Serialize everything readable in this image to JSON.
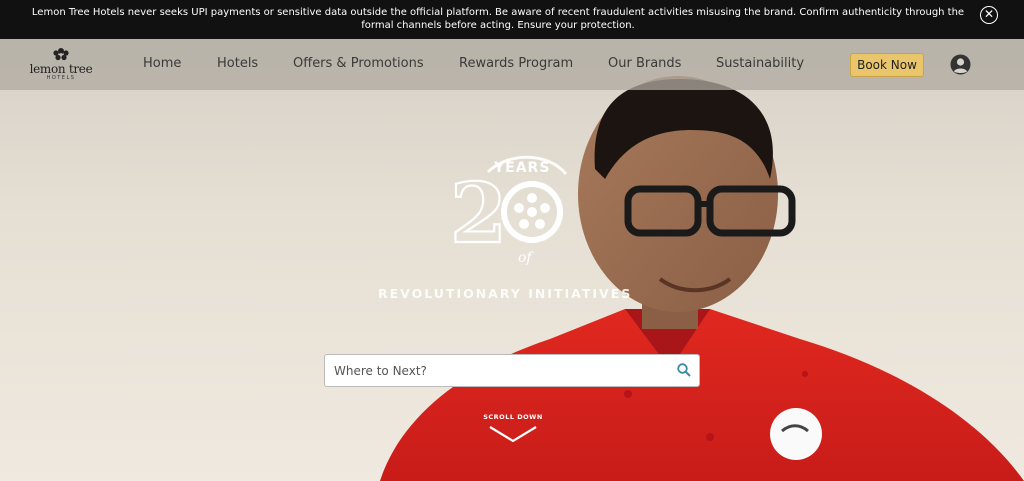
{
  "alert": {
    "message": "Lemon Tree Hotels never seeks UPI payments or sensitive data outside the official platform. Be aware of recent fraudulent activities misusing the brand. Confirm authenticity through the formal channels before acting. Ensure your protection.",
    "close_glyph": "✕"
  },
  "header": {
    "logo": {
      "name": "lemon tree",
      "sub": "HOTELS"
    },
    "nav": [
      {
        "label": "Home"
      },
      {
        "label": "Hotels"
      },
      {
        "label": "Offers & Promotions"
      },
      {
        "label": "Rewards Program"
      },
      {
        "label": "Our Brands"
      },
      {
        "label": "Sustainability"
      }
    ],
    "book_label": "Book Now"
  },
  "hero": {
    "emblem": {
      "years_text": "YEARS",
      "number_2": "2",
      "number_0": "0",
      "of_text": "of"
    },
    "tagline": "REVOLUTIONARY INITIATIVES",
    "search": {
      "placeholder": "Where to Next?",
      "value": ""
    },
    "scroll_label": "SCROLL DOWN"
  },
  "colors": {
    "alert_bg": "#111111",
    "book_button": "#e9c56b",
    "shirt_red": "#d8211f",
    "search_icon": "#3a8aa0"
  },
  "icons": [
    "close-icon",
    "lemon-tree-logo-icon",
    "user-account-icon",
    "search-icon",
    "chevron-down-icon"
  ]
}
